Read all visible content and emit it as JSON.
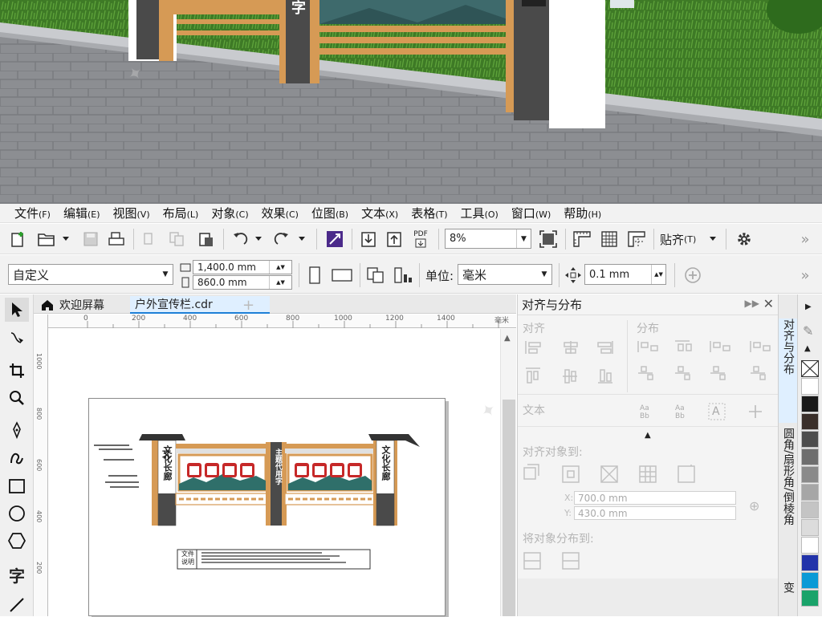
{
  "menu": [
    {
      "label": "文件",
      "acc": "(F)"
    },
    {
      "label": "编辑",
      "acc": "(E)"
    },
    {
      "label": "视图",
      "acc": "(V)"
    },
    {
      "label": "布局",
      "acc": "(L)"
    },
    {
      "label": "对象",
      "acc": "(C)"
    },
    {
      "label": "效果",
      "acc": "(C)"
    },
    {
      "label": "位图",
      "acc": "(B)"
    },
    {
      "label": "文本",
      "acc": "(X)"
    },
    {
      "label": "表格",
      "acc": "(T)"
    },
    {
      "label": "工具",
      "acc": "(O)"
    },
    {
      "label": "窗口",
      "acc": "(W)"
    },
    {
      "label": "帮助",
      "acc": "(H)"
    }
  ],
  "toolbar": {
    "pdf_label": "PDF",
    "zoom": "8%",
    "snap_label": "贴齐",
    "snap_acc": "(T)",
    "more": "»"
  },
  "property_bar": {
    "page_preset": "自定义",
    "width": "1,400.0 mm",
    "height": "860.0 mm",
    "unit_label": "单位:",
    "unit": "毫米",
    "nudge": "0.1 mm",
    "more": "»"
  },
  "tabs": [
    {
      "label": "欢迎屏幕"
    },
    {
      "label": "户外宣传栏.cdr"
    }
  ],
  "ruler": {
    "h_ticks": [
      "0",
      "200",
      "400",
      "600",
      "800",
      "1000",
      "1200",
      "1400"
    ],
    "h_unit": "毫米",
    "v_ticks": [
      "1000",
      "800",
      "600",
      "400",
      "200"
    ]
  },
  "design": {
    "left_sign": "文化长廊",
    "right_sign": "文化长廊",
    "center_sign": "主题代用字",
    "note_label": "文件说明"
  },
  "photo": {
    "sign_char": "字"
  },
  "dock": {
    "title": "对齐与分布",
    "align_label": "对齐",
    "distribute_label": "分布",
    "text_label": "文本",
    "align_to_label": "对齐对象到:",
    "x_value": "700.0 mm",
    "y_value": "430.0 mm",
    "x_label": "X:",
    "y_label": "Y:",
    "distribute_to_label": "将对象分布到:"
  },
  "docker_tabs": [
    {
      "label": "对齐与分布"
    },
    {
      "label": "圆角/扇形角/倒棱角"
    },
    {
      "label": "变"
    }
  ],
  "palette_colors": [
    "#ffffff",
    "#1a1a1a",
    "#3a2f2a",
    "#4d4d4d",
    "#6e6e6e",
    "#8a8a8a",
    "#a6a6a6",
    "#c4c4c4",
    "#dcdcdc",
    "#ffffff",
    "#2233aa",
    "#0a9ad6",
    "#1aa36a"
  ],
  "colors": {
    "accent": "#1d7fd6",
    "wood": "#d69a55",
    "dark_pillar": "#4a4a4a",
    "roof": "#3a3a3a"
  }
}
